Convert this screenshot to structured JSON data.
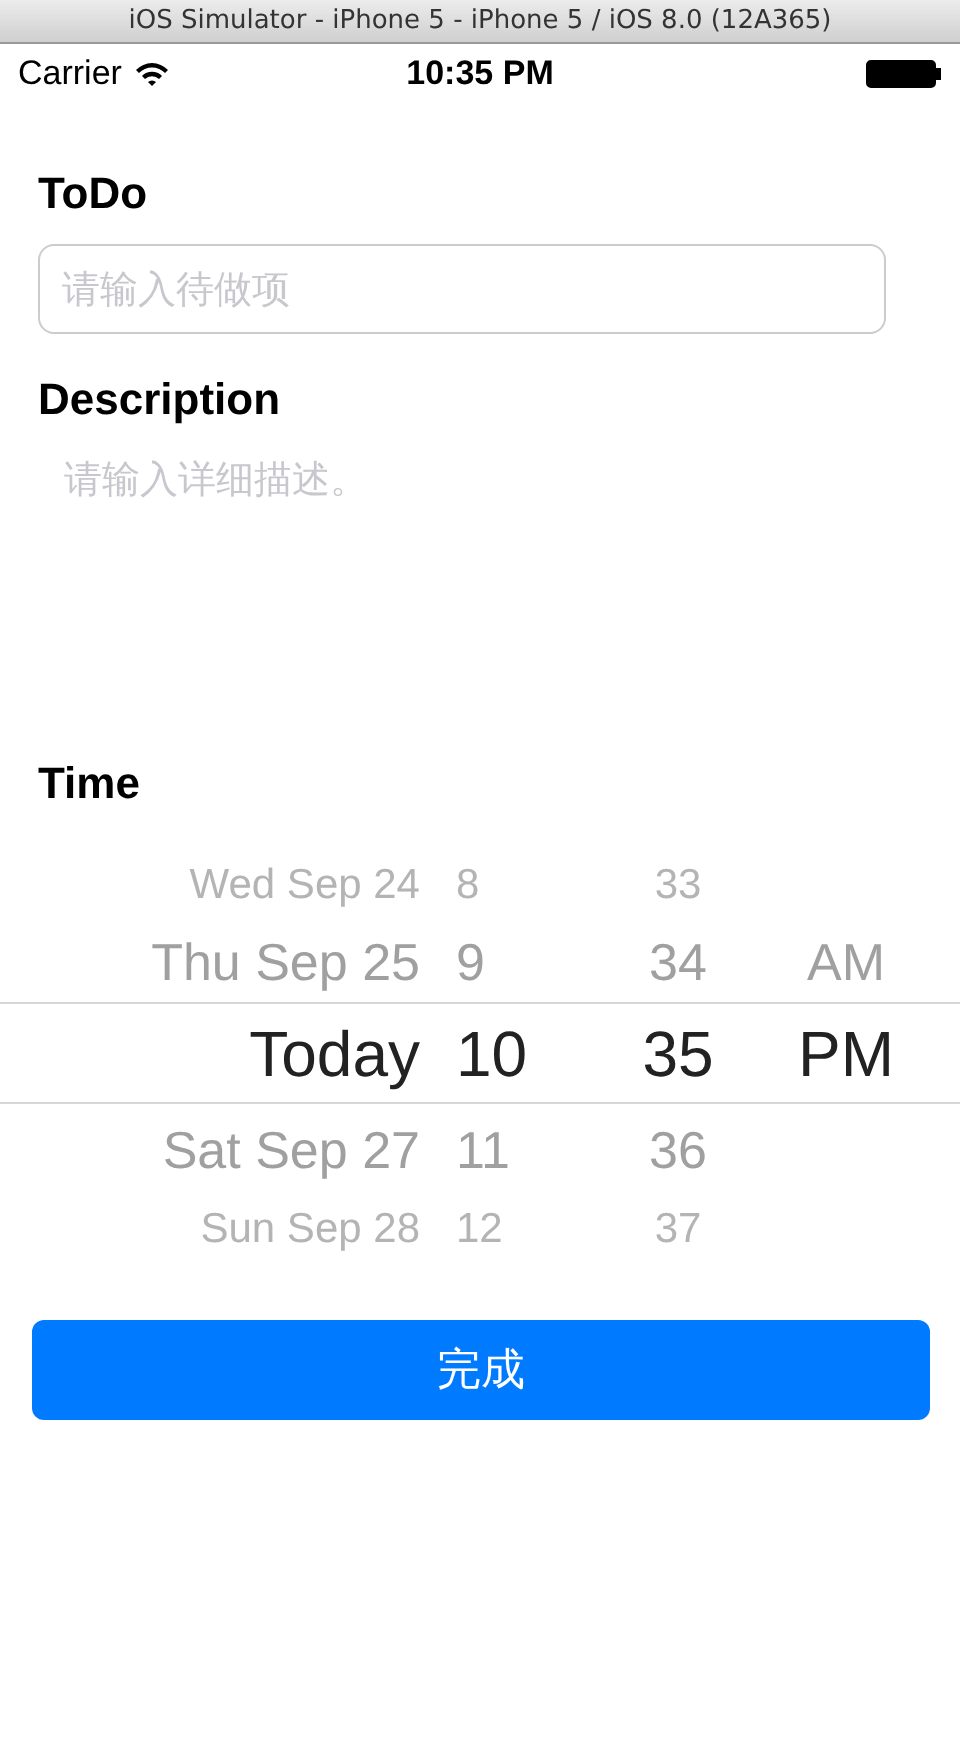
{
  "window": {
    "title": "iOS Simulator - iPhone 5 - iPhone 5 / iOS 8.0 (12A365)"
  },
  "status_bar": {
    "carrier": "Carrier",
    "time": "10:35 PM"
  },
  "todo": {
    "label": "ToDo",
    "placeholder": "请输入待做项"
  },
  "description": {
    "label": "Description",
    "placeholder": "请输入详细描述。"
  },
  "time": {
    "label": "Time"
  },
  "picker_rows": [
    {
      "date": "Wed Sep 24",
      "hour": "8",
      "minute": "33",
      "selected": false
    },
    {
      "date": "Thu Sep 25",
      "hour": "9",
      "minute": "34",
      "period": "AM",
      "selected": false
    },
    {
      "date": "Today",
      "hour": "10",
      "minute": "35",
      "period": "PM",
      "selected": true
    },
    {
      "date": "Sat Sep 27",
      "hour": "11",
      "minute": "36",
      "selected": false
    },
    {
      "date": "Sun Sep 28",
      "hour": "12",
      "minute": "37",
      "selected": false
    }
  ],
  "done_button": {
    "label": "完成"
  }
}
